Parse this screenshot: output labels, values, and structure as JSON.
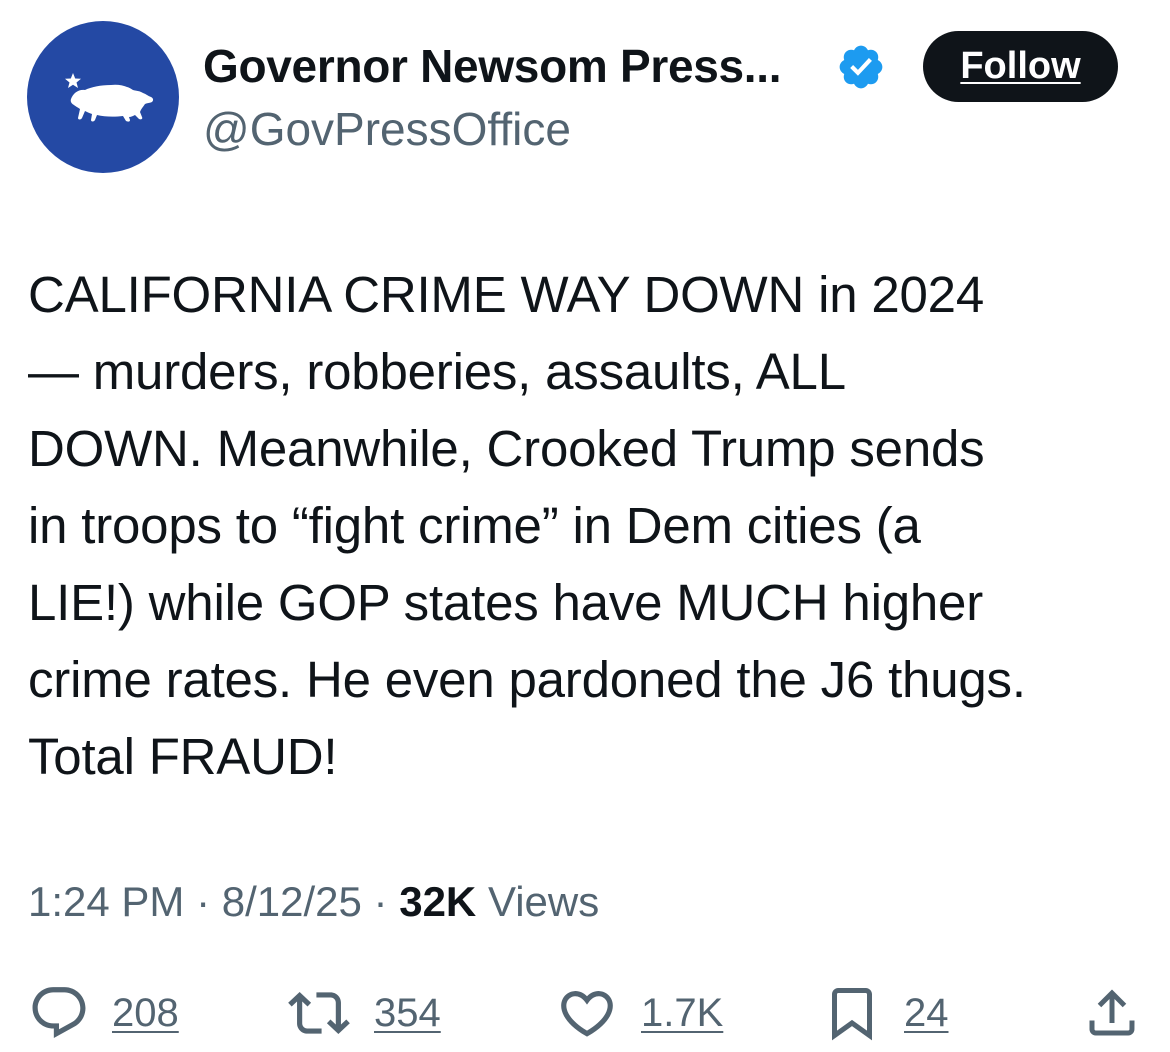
{
  "author": {
    "display_name": "Governor Newsom Press...",
    "handle": "@GovPressOffice",
    "verified_icon": "verified-badge-icon",
    "avatar_icon": "california-bear-star-icon",
    "avatar_color": "#2449a4"
  },
  "follow_button": {
    "label": "Follow"
  },
  "tweet": {
    "text": "CALIFORNIA CRIME WAY DOWN in 2024\n— murders, robberies, assaults, ALL\nDOWN. Meanwhile, Crooked Trump sends\nin troops to “fight crime” in Dem cities (a\nLIE!) while GOP states have MUCH higher\ncrime rates. He even pardoned the J6 thugs.\nTotal FRAUD!"
  },
  "meta": {
    "time": "1:24 PM",
    "separator": " · ",
    "date": "8/12/25",
    "views_count": "32K",
    "views_label": " Views"
  },
  "actions": {
    "replies": {
      "icon": "reply-icon",
      "count": "208"
    },
    "reposts": {
      "icon": "repost-icon",
      "count": "354"
    },
    "likes": {
      "icon": "like-icon",
      "count": "1.7K"
    },
    "bookmarks": {
      "icon": "bookmark-icon",
      "count": "24"
    },
    "share": {
      "icon": "share-icon"
    }
  },
  "colors": {
    "text_primary": "#0f1419",
    "text_secondary": "#536471",
    "verified_blue": "#1d9bf0",
    "button_bg": "#0f1419"
  }
}
